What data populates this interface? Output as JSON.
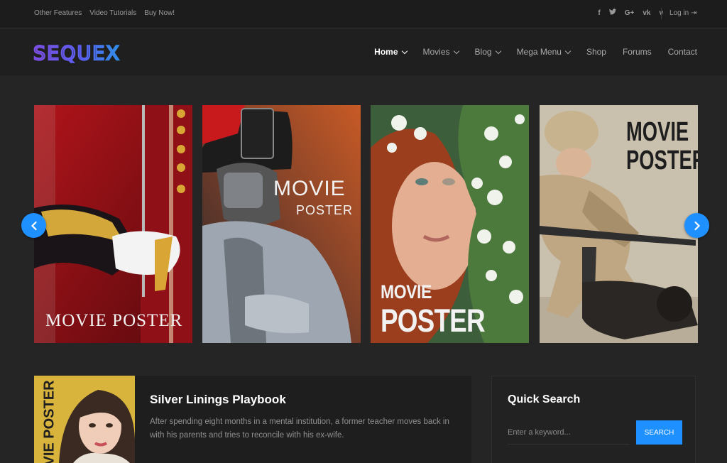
{
  "topbar": {
    "links": [
      "Other Features",
      "Video Tutorials",
      "Buy Now!"
    ],
    "socials": [
      {
        "icon": "facebook-icon",
        "glyph": "f"
      },
      {
        "icon": "twitter-icon",
        "glyph": "t"
      },
      {
        "icon": "google-plus-icon",
        "glyph": "G+"
      },
      {
        "icon": "vk-icon",
        "glyph": "vk"
      },
      {
        "icon": "vimeo-icon",
        "glyph": "v"
      }
    ],
    "login": "Log in ⇥"
  },
  "brand": {
    "logo": "SEQUEX",
    "accent": "#1e90ff"
  },
  "nav": {
    "items": [
      {
        "label": "Home",
        "dropdown": true,
        "active": true
      },
      {
        "label": "Movies",
        "dropdown": true
      },
      {
        "label": "Blog",
        "dropdown": true
      },
      {
        "label": "Mega Menu",
        "dropdown": true
      },
      {
        "label": "Shop",
        "dropdown": false
      },
      {
        "label": "Forums",
        "dropdown": false
      },
      {
        "label": "Contact",
        "dropdown": false
      }
    ]
  },
  "carousel": {
    "posters": [
      {
        "line1": "MOVIE POSTER"
      },
      {
        "line1": "MOVIE",
        "line2": "POSTER"
      },
      {
        "line1": "MOVIE",
        "line2": "POSTER"
      },
      {
        "line1": "MOVIE",
        "line2": "POSTER"
      }
    ]
  },
  "featured": {
    "title": "Silver Linings Playbook",
    "description": "After spending eight months in a mental institution, a former teacher moves back in with his parents and tries to reconcile with his ex-wife.",
    "image_text": "VIE POSTER"
  },
  "quick_search": {
    "title": "Quick Search",
    "placeholder": "Enter a keyword...",
    "button": "SEARCH"
  }
}
